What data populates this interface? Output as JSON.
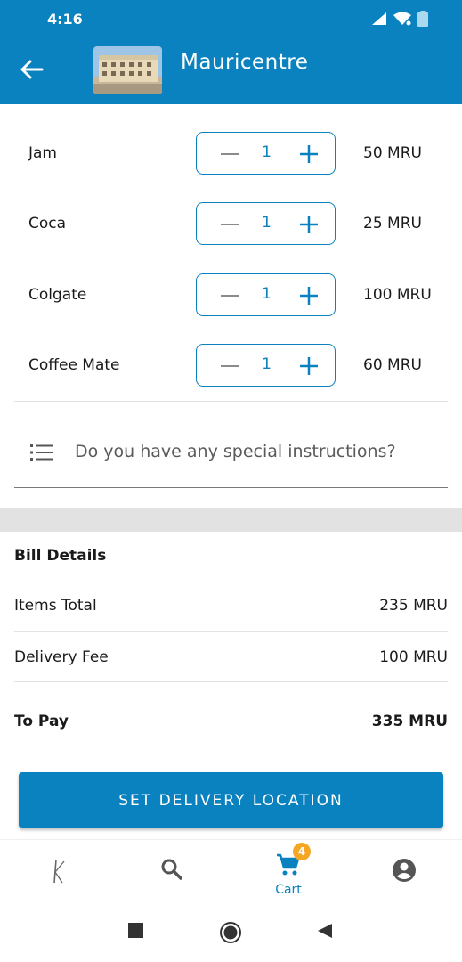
{
  "status_bar": {
    "time": "4:16"
  },
  "header": {
    "store_name": "Mauricentre"
  },
  "cart_items": [
    {
      "name": "Jam",
      "quantity": "1",
      "price": "50 MRU"
    },
    {
      "name": "Coca",
      "quantity": "1",
      "price": "25 MRU"
    },
    {
      "name": "Colgate",
      "quantity": "1",
      "price": "100 MRU"
    },
    {
      "name": "Coffee Mate",
      "quantity": "1",
      "price": "60 MRU"
    }
  ],
  "instructions": {
    "placeholder": "Do you have any special instructions?"
  },
  "bill": {
    "title": "Bill Details",
    "items_total_label": "Items Total",
    "items_total_value": "235 MRU",
    "delivery_fee_label": "Delivery Fee",
    "delivery_fee_value": "100 MRU",
    "to_pay_label": "To Pay",
    "to_pay_value": "335 MRU"
  },
  "cta": {
    "label": "SET DELIVERY LOCATION"
  },
  "bottom_nav": {
    "items": [
      {
        "icon": "brand-k-icon"
      },
      {
        "icon": "search-icon"
      },
      {
        "icon": "cart-icon",
        "label": "Cart",
        "badge": "4"
      },
      {
        "icon": "account-icon"
      }
    ]
  },
  "colors": {
    "primary": "#0a82bf",
    "badge": "#f5a623",
    "band": "#e2e2e2"
  }
}
